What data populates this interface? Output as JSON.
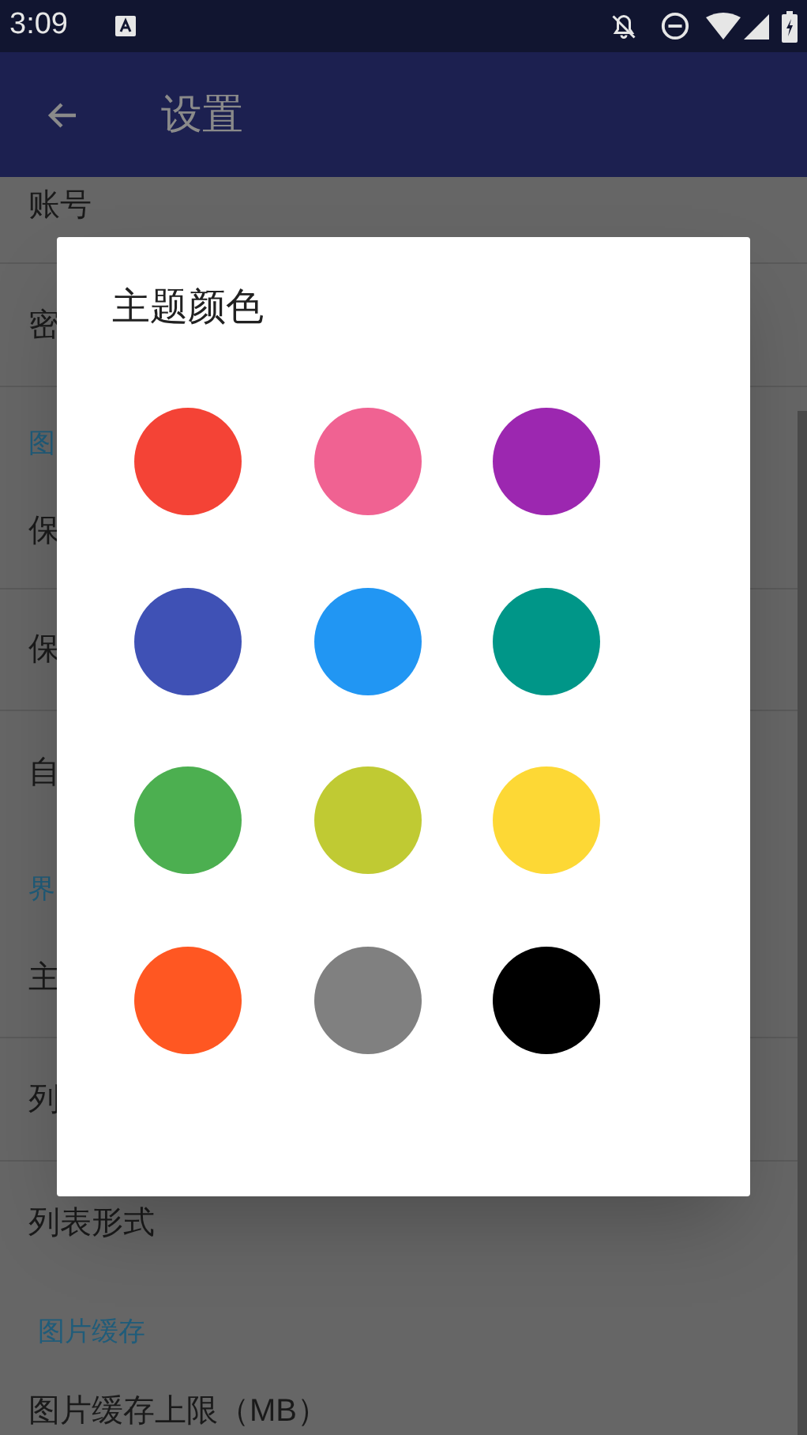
{
  "status_bar": {
    "time": "3:09"
  },
  "app_bar": {
    "title": "设置"
  },
  "settings": [
    {
      "kind": "item",
      "label": "账号"
    },
    {
      "kind": "item",
      "label": "密"
    },
    {
      "kind": "header",
      "label": "图"
    },
    {
      "kind": "item",
      "label": "保"
    },
    {
      "kind": "item",
      "label": "保"
    },
    {
      "kind": "item",
      "label": "自"
    },
    {
      "kind": "header",
      "label": "界"
    },
    {
      "kind": "item",
      "label": "主"
    },
    {
      "kind": "item",
      "label": "列"
    },
    {
      "kind": "item",
      "label": "列表形式"
    },
    {
      "kind": "header",
      "label": "图片缓存"
    },
    {
      "kind": "item",
      "label": "图片缓存上限（MB）"
    }
  ],
  "dialog": {
    "title": "主题颜色",
    "colors": [
      {
        "color": "#f44336"
      },
      {
        "color": "#f06292"
      },
      {
        "color": "#9c27b0"
      },
      {
        "color": "#3f51b5"
      },
      {
        "color": "#2196f3"
      },
      {
        "color": "#009688"
      },
      {
        "color": "#4caf50"
      },
      {
        "color": "#c0ca33"
      },
      {
        "color": "#fdd835"
      },
      {
        "color": "#ff5722"
      },
      {
        "color": "#808080"
      },
      {
        "color": "#000000"
      }
    ]
  }
}
